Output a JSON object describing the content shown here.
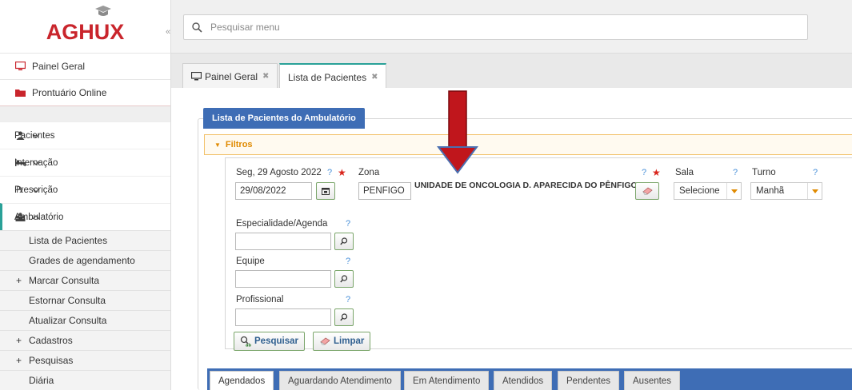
{
  "app": {
    "logo_text": "AGHUX"
  },
  "search": {
    "placeholder": "Pesquisar menu"
  },
  "sidebar": {
    "top_items": [
      {
        "label": "Painel Geral",
        "icon": "monitor-icon"
      },
      {
        "label": "Prontuário Online",
        "icon": "folder-icon"
      }
    ],
    "nav_items": [
      {
        "label": "Pacientes",
        "icon": "person-icon",
        "expanded": false
      },
      {
        "label": "Internação",
        "icon": "bed-icon",
        "expanded": false
      },
      {
        "label": "Prescrição",
        "icon": "prescription-icon",
        "expanded": false
      },
      {
        "label": "Ambulatório",
        "icon": "people-icon",
        "expanded": true
      }
    ],
    "sub_items": [
      {
        "label": "Lista de Pacientes",
        "prefix": ""
      },
      {
        "label": "Grades de agendamento",
        "prefix": ""
      },
      {
        "label": "Marcar Consulta",
        "prefix": "+"
      },
      {
        "label": "Estornar Consulta",
        "prefix": ""
      },
      {
        "label": "Atualizar Consulta",
        "prefix": ""
      },
      {
        "label": "Cadastros",
        "prefix": "+"
      },
      {
        "label": "Pesquisas",
        "prefix": "+"
      },
      {
        "label": "Diária",
        "prefix": ""
      }
    ]
  },
  "tabs": [
    {
      "label": "Painel Geral",
      "active": false
    },
    {
      "label": "Lista de Pacientes",
      "active": true
    }
  ],
  "panel": {
    "title": "Lista de Pacientes do Ambulatório",
    "filters_label": "Filtros"
  },
  "filters": {
    "date_label": "Seg, 29 Agosto 2022",
    "date_value": "29/08/2022",
    "zona_label": "Zona",
    "zona_code": "PENFIGO",
    "zona_name": "UNIDADE DE ONCOLOGIA D. APARECIDA DO PÊNFIGO",
    "sala_label": "Sala",
    "sala_value": "Selecione",
    "turno_label": "Turno",
    "turno_value": "Manhã",
    "especialidade_label": "Especialidade/Agenda",
    "equipe_label": "Equipe",
    "profissional_label": "Profissional",
    "help_mark": "?",
    "required_mark": "★",
    "search_button": "Pesquisar",
    "clear_button": "Limpar"
  },
  "bottom_tabs": [
    {
      "label": "Agendados",
      "active": true
    },
    {
      "label": "Aguardando Atendimento",
      "active": false
    },
    {
      "label": "Em Atendimento",
      "active": false
    },
    {
      "label": "Atendidos",
      "active": false
    },
    {
      "label": "Pendentes",
      "active": false
    },
    {
      "label": "Ausentes",
      "active": false
    }
  ],
  "colors": {
    "brand_red": "#c9252c",
    "accent_teal": "#2aa198",
    "panel_blue": "#3e6db5",
    "filter_orange": "#e08a00",
    "arrow_red": "#c0161c"
  }
}
